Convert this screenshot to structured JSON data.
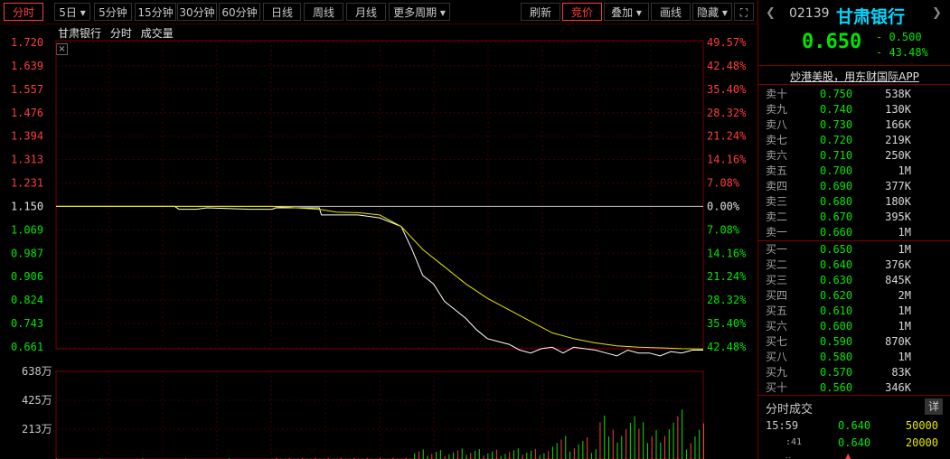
{
  "toolbar": {
    "tabs": [
      "分时",
      "5日",
      "5分钟",
      "15分钟",
      "30分钟",
      "60分钟",
      "日线",
      "周线",
      "月线",
      "更多周期"
    ],
    "right_buttons": [
      "刷新",
      "竞价",
      "叠加",
      "画线",
      "隐藏"
    ]
  },
  "legend": {
    "name": "甘肃银行",
    "mode": "分时",
    "volume": "成交量"
  },
  "price_axis": [
    "1.720",
    "1.639",
    "1.557",
    "1.476",
    "1.394",
    "1.313",
    "1.231",
    "1.150",
    "1.069",
    "0.987",
    "0.906",
    "0.824",
    "0.743",
    "0.661"
  ],
  "pct_axis": [
    "49.57%",
    "42.48%",
    "35.40%",
    "28.32%",
    "21.24%",
    "14.16%",
    "7.08%",
    "0.00%",
    "7.08%",
    "14.16%",
    "21.24%",
    "28.32%",
    "35.40%",
    "42.48%"
  ],
  "volume_axis": [
    "638万",
    "425万",
    "213万"
  ],
  "chart_data": {
    "type": "line",
    "series": [
      {
        "values_x": [
          0,
          55,
          57,
          65,
          70,
          90,
          100,
          102,
          110,
          122,
          123,
          130,
          140,
          145,
          150,
          160,
          165,
          170,
          175,
          180,
          185,
          190,
          195,
          200,
          205,
          210,
          215,
          220,
          225,
          230,
          235,
          240,
          245,
          250,
          255,
          260,
          265,
          270,
          275,
          280,
          285,
          290,
          295,
          300
        ],
        "values": [
          1.15,
          1.15,
          1.14,
          1.14,
          1.145,
          1.14,
          1.14,
          1.145,
          1.145,
          1.145,
          1.12,
          1.12,
          1.12,
          1.115,
          1.11,
          1.08,
          1.0,
          0.91,
          0.88,
          0.82,
          0.79,
          0.76,
          0.72,
          0.69,
          0.68,
          0.67,
          0.65,
          0.64,
          0.655,
          0.66,
          0.64,
          0.66,
          0.655,
          0.65,
          0.64,
          0.63,
          0.65,
          0.64,
          0.64,
          0.63,
          0.645,
          0.64,
          0.65,
          0.65
        ]
      },
      {
        "values_x": [
          0,
          55,
          100,
          122,
          130,
          140,
          150,
          160,
          170,
          180,
          190,
          200,
          210,
          220,
          230,
          240,
          250,
          260,
          270,
          280,
          290,
          300
        ],
        "values": [
          1.15,
          1.15,
          1.15,
          1.14,
          1.13,
          1.128,
          1.12,
          1.08,
          1.0,
          0.94,
          0.88,
          0.83,
          0.79,
          0.75,
          0.71,
          0.69,
          0.675,
          0.665,
          0.66,
          0.658,
          0.655,
          0.654
        ]
      }
    ],
    "ylim": [
      0.661,
      1.72
    ],
    "vol_ylim": [
      0,
      638
    ]
  },
  "quote": {
    "code": "02139",
    "name": "甘肃银行",
    "price": "0.650",
    "change": "- 0.500",
    "pct": "- 43.48%"
  },
  "promo": "炒港美股，用东财国际APP",
  "sell": [
    {
      "label": "卖十",
      "price": "0.750",
      "vol": "538K"
    },
    {
      "label": "卖九",
      "price": "0.740",
      "vol": "130K"
    },
    {
      "label": "卖八",
      "price": "0.730",
      "vol": "166K"
    },
    {
      "label": "卖七",
      "price": "0.720",
      "vol": "219K"
    },
    {
      "label": "卖六",
      "price": "0.710",
      "vol": "250K"
    },
    {
      "label": "卖五",
      "price": "0.700",
      "vol": "1M"
    },
    {
      "label": "卖四",
      "price": "0.690",
      "vol": "377K"
    },
    {
      "label": "卖三",
      "price": "0.680",
      "vol": "180K"
    },
    {
      "label": "卖二",
      "price": "0.670",
      "vol": "395K"
    },
    {
      "label": "卖一",
      "price": "0.660",
      "vol": "1M"
    }
  ],
  "buy": [
    {
      "label": "买一",
      "price": "0.650",
      "vol": "1M"
    },
    {
      "label": "买二",
      "price": "0.640",
      "vol": "376K"
    },
    {
      "label": "买三",
      "price": "0.630",
      "vol": "845K"
    },
    {
      "label": "买四",
      "price": "0.620",
      "vol": "2M"
    },
    {
      "label": "买五",
      "price": "0.610",
      "vol": "1M"
    },
    {
      "label": "买六",
      "price": "0.600",
      "vol": "1M"
    },
    {
      "label": "买七",
      "price": "0.590",
      "vol": "870K"
    },
    {
      "label": "买八",
      "price": "0.580",
      "vol": "1M"
    },
    {
      "label": "买九",
      "price": "0.570",
      "vol": "83K"
    },
    {
      "label": "买十",
      "price": "0.560",
      "vol": "346K"
    }
  ],
  "trades_title": "分时成交",
  "trades_detail": "详",
  "trades": [
    {
      "time": "15:59",
      "price": "0.640",
      "vol": "50000"
    },
    {
      "time": ":41",
      "price": "0.640",
      "vol": "20000"
    }
  ],
  "colors": {
    "up": "#ff3c3c",
    "down": "#00e600",
    "price_line": "#ffffff",
    "avg_line": "#e6e600",
    "accent": "#00d8ff"
  }
}
